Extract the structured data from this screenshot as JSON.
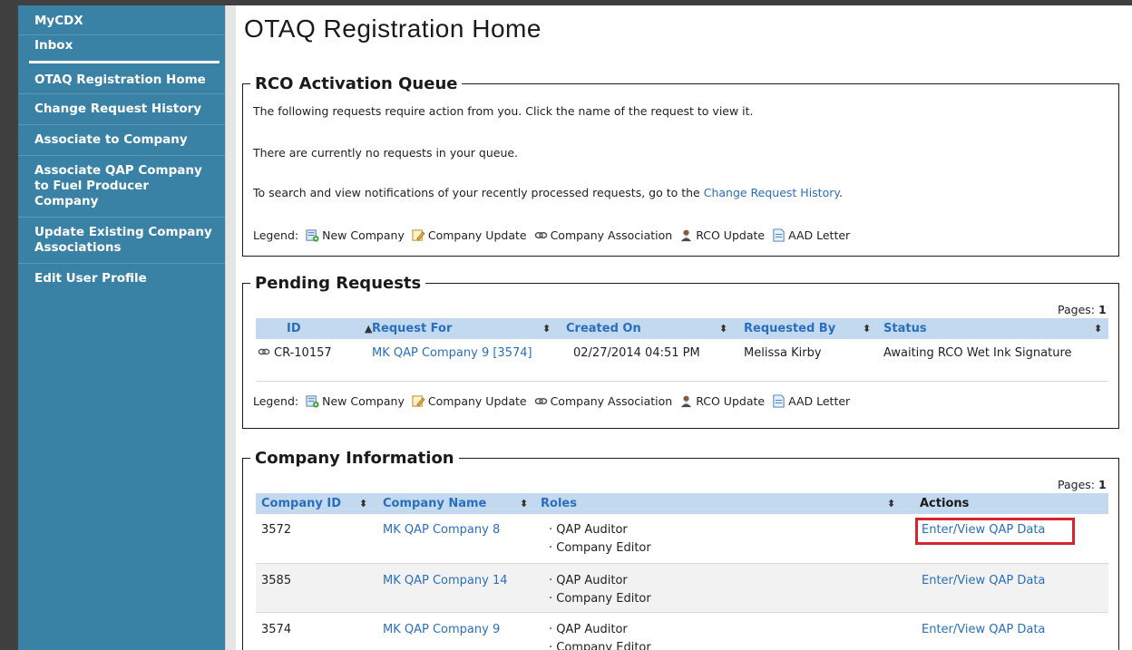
{
  "sidebar": {
    "items": [
      {
        "label": "MyCDX"
      },
      {
        "label": "Inbox"
      },
      {
        "label": "OTAQ Registration Home"
      },
      {
        "label": "Change Request History"
      },
      {
        "label": "Associate to Company"
      },
      {
        "label": "Associate QAP Company to Fuel Producer Company"
      },
      {
        "label": "Update Existing Company Associations"
      },
      {
        "label": "Edit User Profile"
      }
    ]
  },
  "page": {
    "title": "OTAQ Registration Home"
  },
  "rco_queue": {
    "title": "RCO Activation Queue",
    "intro": "The following requests require action from you. Click the name of the request to view it.",
    "empty_message": "There are currently no requests in your queue.",
    "history_prefix": "To search and view notifications of your recently processed requests, go to the ",
    "history_link": "Change Request History",
    "history_suffix": "."
  },
  "legend": {
    "label": "Legend:",
    "items": [
      {
        "icon": "new-company-icon",
        "label": "New Company"
      },
      {
        "icon": "company-update-icon",
        "label": "Company Update"
      },
      {
        "icon": "company-association-icon",
        "label": "Company Association"
      },
      {
        "icon": "rco-update-icon",
        "label": "RCO Update"
      },
      {
        "icon": "aad-letter-icon",
        "label": "AAD Letter"
      }
    ]
  },
  "pending": {
    "title": "Pending Requests",
    "pages_label": "Pages:",
    "pages_value": "1",
    "columns": [
      "ID",
      "Request For",
      "Created On",
      "Requested By",
      "Status"
    ],
    "rows": [
      {
        "icon": "company-association-icon",
        "id": "CR-10157",
        "request_for": "MK QAP Company 9 [3574]",
        "created_on": "02/27/2014 04:51 PM",
        "requested_by": "Melissa Kirby",
        "status": "Awaiting RCO Wet Ink Signature"
      }
    ]
  },
  "company": {
    "title": "Company Information",
    "pages_label": "Pages:",
    "pages_value": "1",
    "columns": [
      "Company ID",
      "Company Name",
      "Roles",
      "Actions"
    ],
    "rows": [
      {
        "id": "3572",
        "name": "MK QAP Company 8",
        "roles": [
          "QAP Auditor",
          "Company Editor"
        ],
        "action": "Enter/View QAP Data"
      },
      {
        "id": "3585",
        "name": "MK QAP Company 14",
        "roles": [
          "QAP Auditor",
          "Company Editor"
        ],
        "action": "Enter/View QAP Data"
      },
      {
        "id": "3574",
        "name": "MK QAP Company 9",
        "roles": [
          "QAP Auditor",
          "Company Editor"
        ],
        "action": "Enter/View QAP Data"
      }
    ]
  },
  "colors": {
    "sidebar": "#3a81a6",
    "link": "#2a6fbb",
    "table_header": "#c3d9ef",
    "highlight": "#d9232e"
  }
}
